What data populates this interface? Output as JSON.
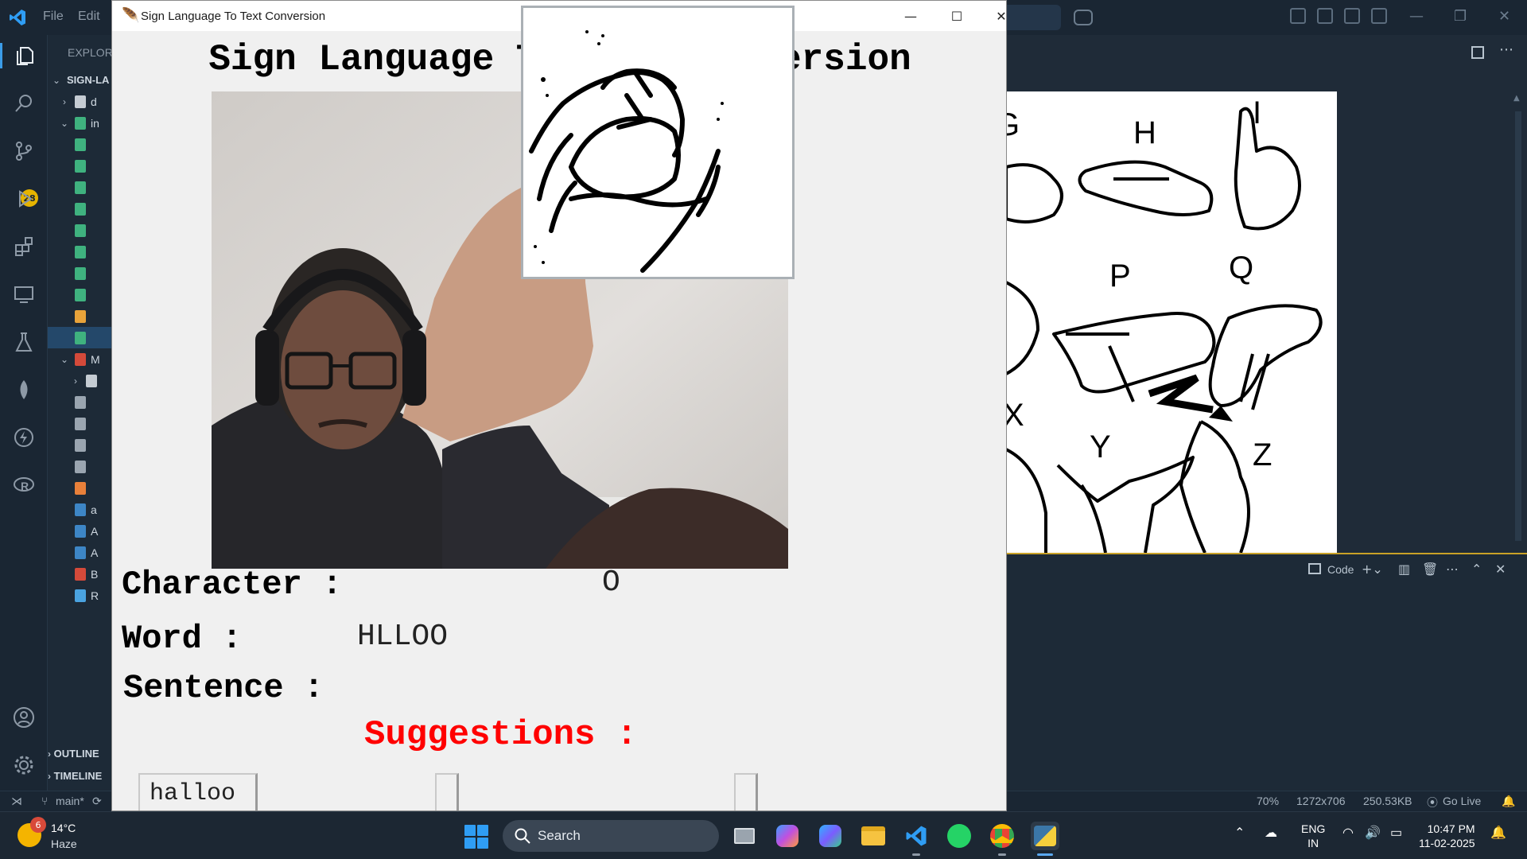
{
  "vscode": {
    "menu": [
      "File",
      "Edit"
    ],
    "explorer_header": "EXPLORER",
    "root_folder": "SIGN-LA",
    "badge_count": "28",
    "sidebar_rows": [
      {
        "label": "d",
        "kind": "folder-collapsed"
      },
      {
        "label": "in",
        "kind": "folder-open"
      },
      {
        "label": "",
        "kind": "image-file"
      },
      {
        "label": "",
        "kind": "image-file"
      },
      {
        "label": "",
        "kind": "image-file"
      },
      {
        "label": "",
        "kind": "image-file"
      },
      {
        "label": "",
        "kind": "image-file"
      },
      {
        "label": "",
        "kind": "image-file"
      },
      {
        "label": "",
        "kind": "image-file"
      },
      {
        "label": "",
        "kind": "image-file"
      },
      {
        "label": "",
        "kind": "clapper-file"
      },
      {
        "label": "",
        "kind": "image-file-selected"
      },
      {
        "label": "M",
        "kind": "folder-open-red"
      },
      {
        "label": "",
        "kind": "folder-collapsed"
      },
      {
        "label": "",
        "kind": "file"
      },
      {
        "label": "",
        "kind": "file"
      },
      {
        "label": "",
        "kind": "file"
      },
      {
        "label": "",
        "kind": "file"
      },
      {
        "label": "",
        "kind": "config-file"
      },
      {
        "label": "a",
        "kind": "python-file"
      },
      {
        "label": "A",
        "kind": "python-file"
      },
      {
        "label": "A",
        "kind": "python-file"
      },
      {
        "label": "B",
        "kind": "pdf-file"
      },
      {
        "label": "R",
        "kind": "info-file"
      }
    ],
    "outline_label": "OUTLINE",
    "timeline_label": "TIMELINE",
    "asl_letters": [
      "G",
      "H",
      "I",
      "P",
      "Q",
      "X",
      "Y",
      "Z",
      "Z"
    ],
    "panel_code_label": "Code",
    "statusbar": {
      "branch": "main*",
      "zoom": "70%",
      "dimensions": "1272x706",
      "file_size": "250.53KB",
      "go_live": "Go Live"
    }
  },
  "app": {
    "window_title": "Sign Language To Text Conversion",
    "heading": "Sign Language To Text Conversion",
    "character_label": "Character :",
    "character_value": "O",
    "word_label": "Word :",
    "word_value": "HLLOO",
    "sentence_label": "Sentence :",
    "sentence_value": "",
    "suggestions_label": "Suggestions :",
    "suggestions": [
      "halloo",
      "",
      ""
    ]
  },
  "taskbar": {
    "weather_badge": "6",
    "temperature": "14°C",
    "weather": "Haze",
    "search_label": "Search",
    "lang_line1": "ENG",
    "lang_line2": "IN",
    "time": "10:47 PM",
    "date": "11-02-2025"
  },
  "colors": {
    "suggestions_red": "#ff0000",
    "vscode_accent": "#3b9ce8",
    "badge_yellow": "#e6b400"
  }
}
